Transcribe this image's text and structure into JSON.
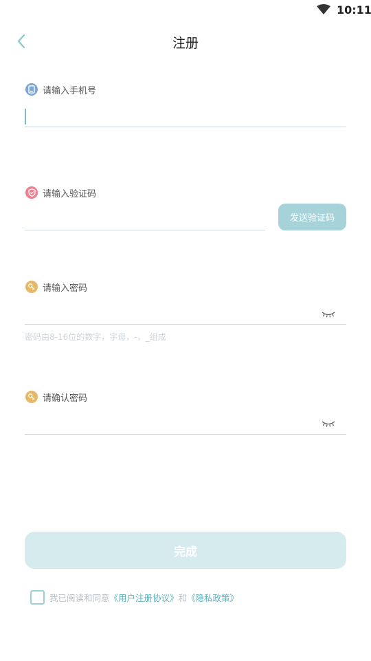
{
  "status_bar": {
    "time": "10:11"
  },
  "header": {
    "title": "注册"
  },
  "fields": {
    "phone": {
      "label": "请输入手机号",
      "value": ""
    },
    "code": {
      "label": "请输入验证码",
      "value": "",
      "send_button": "发送验证码"
    },
    "password": {
      "label": "请输入密码",
      "value": "",
      "hint": "密码由8-16位的数字，字母，-，_组成"
    },
    "confirm": {
      "label": "请确认密码",
      "value": ""
    }
  },
  "submit": {
    "label": "完成"
  },
  "agreement": {
    "prefix": "我已阅读和同意",
    "user_agreement": "《用户注册协议》",
    "joiner": "和",
    "privacy_policy": "《隐私政策》",
    "checked": false
  },
  "colors": {
    "accent": "#a6d3d9",
    "accent_light": "#d6ebee",
    "link": "#5cb2bd",
    "phone_icon": "#7fa7d6",
    "code_icon": "#ef7f91",
    "key_icon": "#e7b865"
  },
  "icons": [
    "wifi-icon",
    "back-arrow-icon",
    "phone-icon",
    "shield-icon",
    "key-icon",
    "eye-closed-icon"
  ]
}
